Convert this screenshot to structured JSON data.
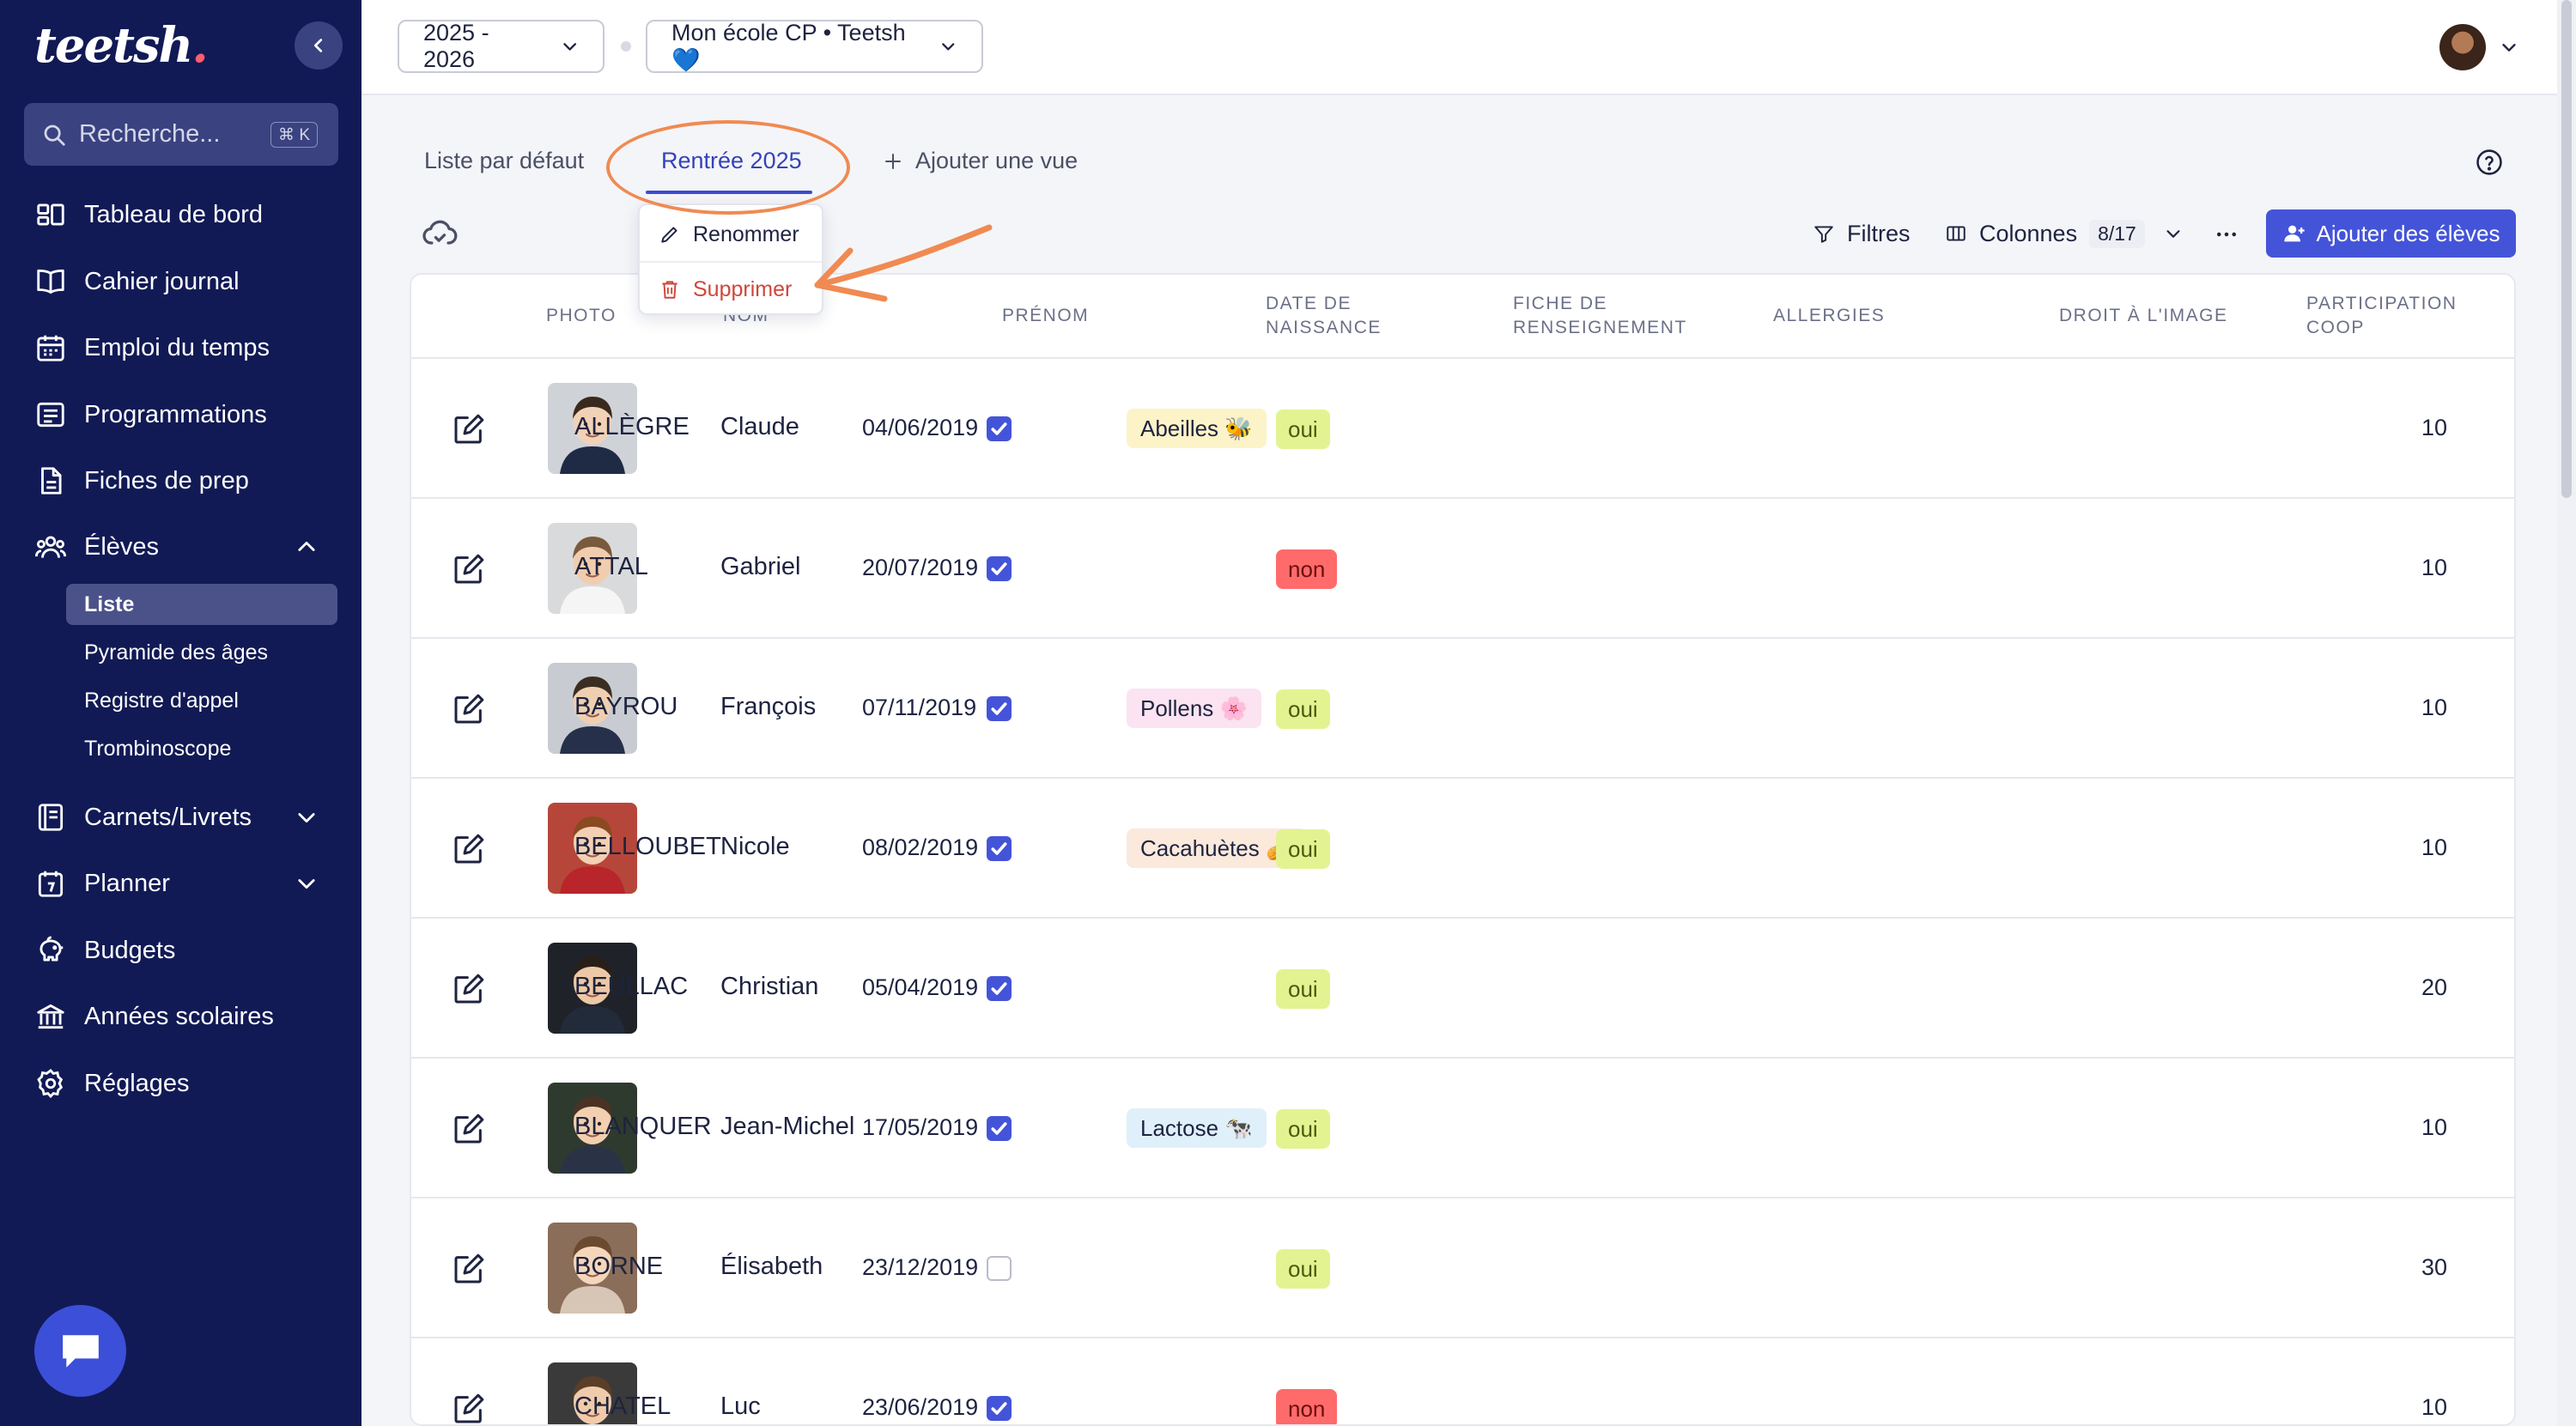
{
  "brand": {
    "logo_text": "teetsh"
  },
  "sidebar": {
    "search_placeholder": "Recherche...",
    "search_shortcut": "⌘ K",
    "items": [
      {
        "label": "Tableau de bord",
        "icon": "dashboard-icon"
      },
      {
        "label": "Cahier journal",
        "icon": "book-icon"
      },
      {
        "label": "Emploi du temps",
        "icon": "calendar-icon"
      },
      {
        "label": "Programmations",
        "icon": "list-icon"
      },
      {
        "label": "Fiches de prep",
        "icon": "document-icon"
      },
      {
        "label": "Élèves",
        "icon": "users-icon",
        "expanded": true
      },
      {
        "label": "Carnets/Livrets",
        "icon": "notebook-icon"
      },
      {
        "label": "Planner",
        "icon": "planner-icon"
      },
      {
        "label": "Budgets",
        "icon": "piggy-bank-icon"
      },
      {
        "label": "Années scolaires",
        "icon": "school-icon"
      },
      {
        "label": "Réglages",
        "icon": "gear-icon"
      }
    ],
    "sub_items": [
      {
        "label": "Liste",
        "active": true
      },
      {
        "label": "Pyramide des âges"
      },
      {
        "label": "Registre d'appel"
      },
      {
        "label": "Trombinoscope"
      }
    ]
  },
  "topbar": {
    "year_select": "2025 - 2026",
    "school_select": "Mon école CP • Teetsh 💙"
  },
  "views": {
    "tabs": [
      {
        "label": "Liste par défaut",
        "active": false
      },
      {
        "label": "Rentrée 2025",
        "active": true
      }
    ],
    "add_view_label": "Ajouter une vue",
    "menu": {
      "rename": "Renommer",
      "delete": "Supprimer"
    }
  },
  "toolbar": {
    "filters_label": "Filtres",
    "columns_label": "Colonnes",
    "columns_count": "8/17",
    "add_students_label": "Ajouter des élèves"
  },
  "table": {
    "headers": {
      "photo": "PHOTO",
      "name": "NOM",
      "firstname": "PRÉNOM",
      "birthdate_1": "DATE DE",
      "birthdate_2": "NAISSANCE",
      "info_1": "FICHE DE",
      "info_2": "RENSEIGNEMENT",
      "allergies": "ALLERGIES",
      "image_rights": "DROIT À L'IMAGE",
      "coop_1": "PARTICIPATION",
      "coop_2": "COOP"
    },
    "rows": [
      {
        "name": "ALLÈGRE",
        "firstname": "Claude",
        "birthdate": "04/06/2019",
        "info_sheet": true,
        "allergy": "Abeilles 🐝",
        "image_rights": "oui",
        "coop": "10"
      },
      {
        "name": "ATTAL",
        "firstname": "Gabriel",
        "birthdate": "20/07/2019",
        "info_sheet": true,
        "allergy": "",
        "image_rights": "non",
        "coop": "10"
      },
      {
        "name": "BAYROU",
        "firstname": "François",
        "birthdate": "07/11/2019",
        "info_sheet": true,
        "allergy": "Pollens 🌸",
        "image_rights": "oui",
        "coop": "10"
      },
      {
        "name": "BELLOUBET",
        "firstname": "Nicole",
        "birthdate": "08/02/2019",
        "info_sheet": true,
        "allergy": "Cacahuètes 🥜",
        "image_rights": "oui",
        "coop": "10"
      },
      {
        "name": "BEULLAC",
        "firstname": "Christian",
        "birthdate": "05/04/2019",
        "info_sheet": true,
        "allergy": "",
        "image_rights": "oui",
        "coop": "20"
      },
      {
        "name": "BLANQUER",
        "firstname": "Jean-Michel",
        "birthdate": "17/05/2019",
        "info_sheet": true,
        "allergy": "Lactose 🐄",
        "image_rights": "oui",
        "coop": "10"
      },
      {
        "name": "BORNE",
        "firstname": "Élisabeth",
        "birthdate": "23/12/2019",
        "info_sheet": false,
        "allergy": "",
        "image_rights": "oui",
        "coop": "30"
      },
      {
        "name": "CHATEL",
        "firstname": "Luc",
        "birthdate": "23/06/2019",
        "info_sheet": true,
        "allergy": "",
        "image_rights": "non",
        "coop": "10"
      }
    ]
  },
  "colors": {
    "sidebar_bg": "#111a55",
    "accent": "#4454d8",
    "oui_bg": "#e3f391",
    "non_bg": "#ff6b6b",
    "annotation": "#f08a52",
    "allergy_colors": [
      "#fdf3c8",
      "#fbe3f1",
      "#fbe9dc",
      "#dff0fb"
    ]
  }
}
